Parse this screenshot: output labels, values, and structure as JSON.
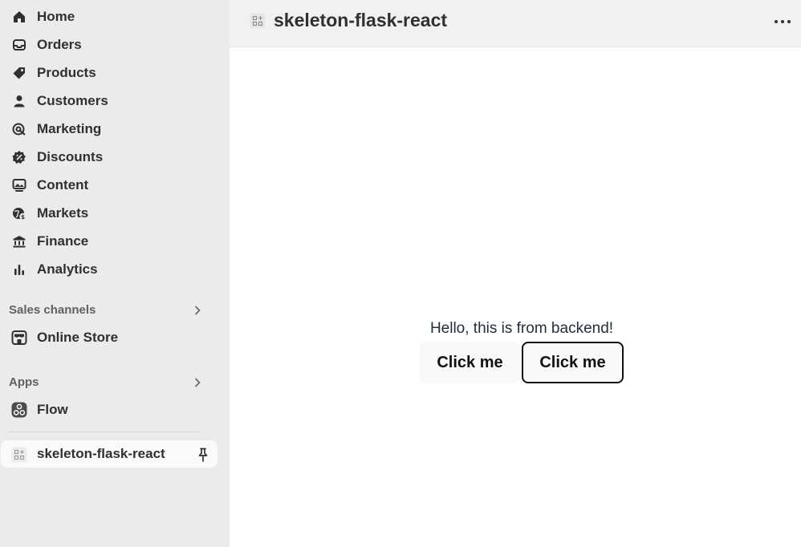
{
  "sidebar": {
    "items": [
      {
        "label": "Home",
        "icon": "home-icon"
      },
      {
        "label": "Orders",
        "icon": "inbox-icon"
      },
      {
        "label": "Products",
        "icon": "tag-icon"
      },
      {
        "label": "Customers",
        "icon": "person-icon"
      },
      {
        "label": "Marketing",
        "icon": "target-icon"
      },
      {
        "label": "Discounts",
        "icon": "discount-badge-icon"
      },
      {
        "label": "Content",
        "icon": "image-frame-icon"
      },
      {
        "label": "Markets",
        "icon": "globe-dollar-icon"
      },
      {
        "label": "Finance",
        "icon": "bank-icon"
      },
      {
        "label": "Analytics",
        "icon": "bar-chart-icon"
      }
    ],
    "sales_channels": {
      "heading": "Sales channels",
      "items": [
        {
          "label": "Online Store",
          "icon": "storefront-icon"
        }
      ]
    },
    "apps": {
      "heading": "Apps",
      "items": [
        {
          "label": "Flow",
          "icon": "flow-icon"
        }
      ]
    },
    "active_app": {
      "label": "skeleton-flask-react",
      "icon": "app-grid-icon",
      "pin_icon": "pin-icon"
    }
  },
  "header": {
    "title": "skeleton-flask-react",
    "icon": "app-grid-icon",
    "more_icon": "ellipsis-icon"
  },
  "content": {
    "message": "Hello, this is from backend!",
    "buttons": [
      {
        "label": "Click me"
      },
      {
        "label": "Click me"
      }
    ]
  }
}
